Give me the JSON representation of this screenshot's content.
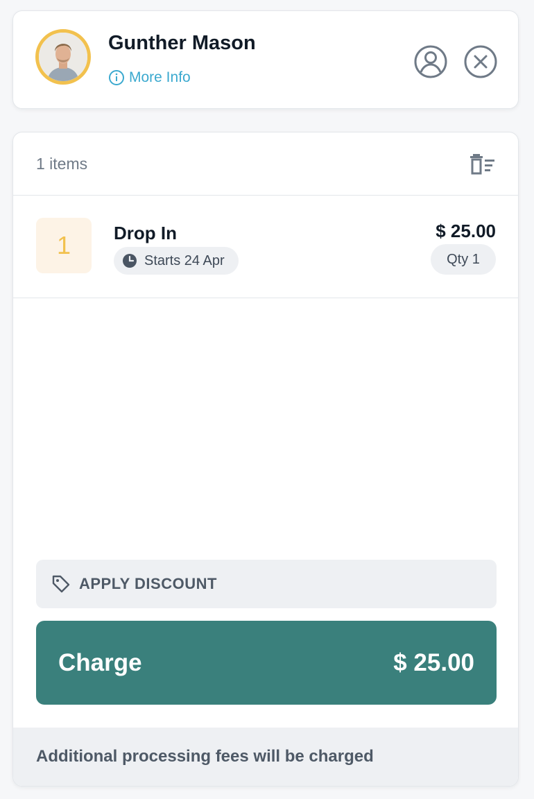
{
  "customer": {
    "name": "Gunther Mason",
    "more_info_label": "More Info"
  },
  "cart": {
    "items_count_label": "1 items",
    "items": [
      {
        "quantity_badge": "1",
        "name": "Drop In",
        "start_label": "Starts 24 Apr",
        "price": "$ 25.00",
        "qty_label": "Qty 1"
      }
    ],
    "discount_label": "APPLY DISCOUNT",
    "charge_label": "Charge",
    "charge_amount": "$ 25.00",
    "fees_note": "Additional processing fees will be charged"
  },
  "icons": {
    "avatar": "user-photo",
    "info": "info-circle-icon",
    "profile": "user-circle-icon",
    "close": "close-circle-icon",
    "clear_cart": "trash-list-icon",
    "clock": "clock-icon",
    "tag": "tag-icon"
  },
  "colors": {
    "accent": "#3a807c",
    "avatar_ring": "#f2c14e",
    "link": "#3ba9cf",
    "qty_badge_bg": "#fdf3e6"
  }
}
